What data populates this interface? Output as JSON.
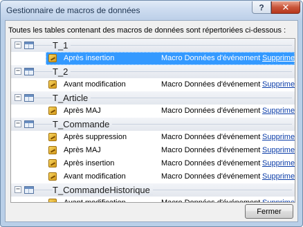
{
  "window": {
    "title": "Gestionnaire de macros de données",
    "help_label": "?",
    "close_label": "✕"
  },
  "intro_text": "Toutes les tables contenant des macros de données sont répertoriées ci-dessous :",
  "tables": [
    {
      "name": "T_1",
      "toggle": "−",
      "macros": [
        {
          "event": "Après insertion",
          "type": "Macro Données d'événement",
          "action": "Supprimer",
          "selected": true
        }
      ]
    },
    {
      "name": "T_2",
      "toggle": "−",
      "macros": [
        {
          "event": "Avant modification",
          "type": "Macro Données d'événement",
          "action": "Supprimer"
        }
      ]
    },
    {
      "name": "T_Article",
      "toggle": "−",
      "macros": [
        {
          "event": "Après MAJ",
          "type": "Macro Données d'événement",
          "action": "Supprimer"
        }
      ]
    },
    {
      "name": "T_Commande",
      "toggle": "−",
      "macros": [
        {
          "event": "Après suppression",
          "type": "Macro Données d'événement",
          "action": "Supprimer"
        },
        {
          "event": "Après MAJ",
          "type": "Macro Données d'événement",
          "action": "Supprimer"
        },
        {
          "event": "Après insertion",
          "type": "Macro Données d'événement",
          "action": "Supprimer"
        },
        {
          "event": "Avant modification",
          "type": "Macro Données d'événement",
          "action": "Supprimer"
        }
      ]
    },
    {
      "name": "T_CommandeHistorique",
      "toggle": "−",
      "macros": [
        {
          "event": "Avant modification",
          "type": "Macro Données d'événement",
          "action": "Supprimer"
        }
      ]
    }
  ],
  "footer": {
    "close_button": "Fermer"
  },
  "colors": {
    "selection": "#3399ff",
    "link": "#0a3ca8",
    "close_button_red": "#c9553a"
  }
}
